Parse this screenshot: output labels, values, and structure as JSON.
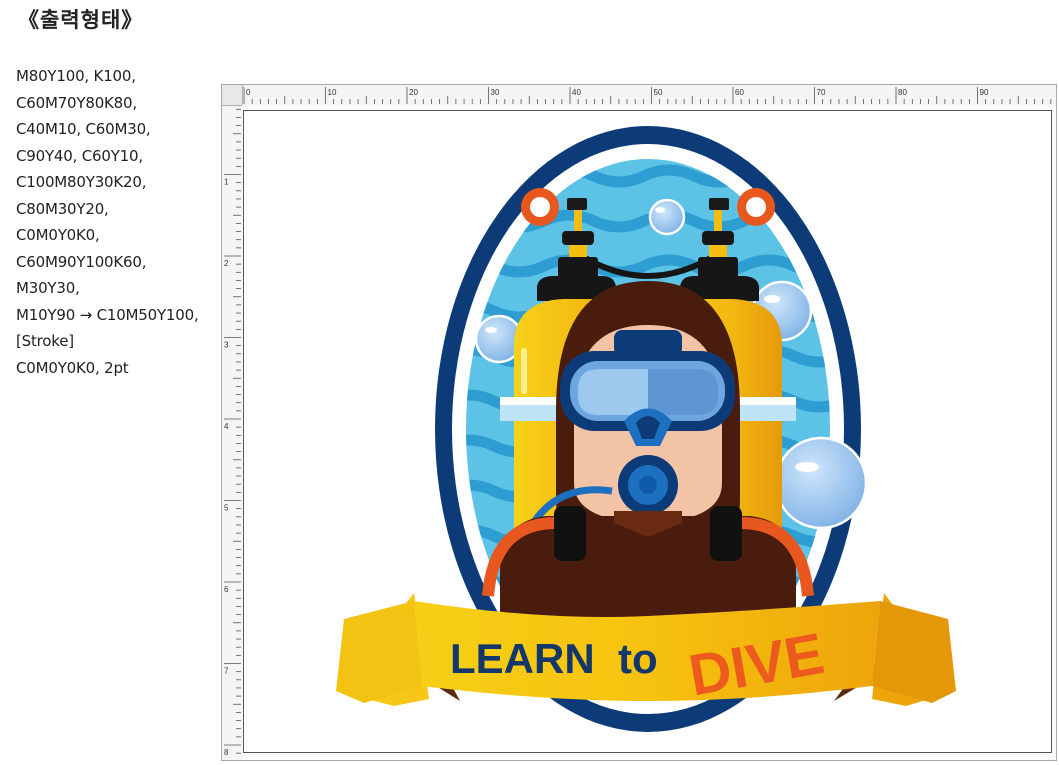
{
  "title": "《출력형태》",
  "specs": [
    "M80Y100, K100,",
    "C60M70Y80K80,",
    "C40M10, C60M30,",
    "C90Y40, C60Y10,",
    "C100M80Y30K20,",
    "C80M30Y20,",
    "C0M0Y0K0,",
    "C60M90Y100K60,",
    "M30Y30,",
    "M10Y90 → C10M50Y100,",
    "[Stroke]",
    "C0M0Y0K0, 2pt"
  ],
  "ruler": {
    "h_labels": [
      "0",
      "10",
      "20",
      "30",
      "40",
      "50",
      "60",
      "70",
      "80",
      "90"
    ],
    "v_labels": [
      "1",
      "2",
      "3",
      "4",
      "5",
      "6",
      "7",
      "8"
    ]
  },
  "artwork": {
    "text_learn": "LEARN",
    "text_to": "to",
    "text_dive": "DIVE"
  },
  "colors": {
    "navy": "#0d3b78",
    "water_light": "#5cc3e6",
    "water_wave": "#2e9dd1",
    "skin": "#f3c3a6",
    "hood": "#4a1c0e",
    "tank_yellow": "#f4bd10",
    "ribbon_yellow": "#f7c617",
    "ribbon_shadow": "#5a2a0a",
    "dive_orange": "#ec5a1d",
    "learn_navy": "#13376b",
    "mask_blue": "#1d6fbf",
    "lens_blue": "#8fbde8",
    "orange_ring": "#e8571e"
  }
}
